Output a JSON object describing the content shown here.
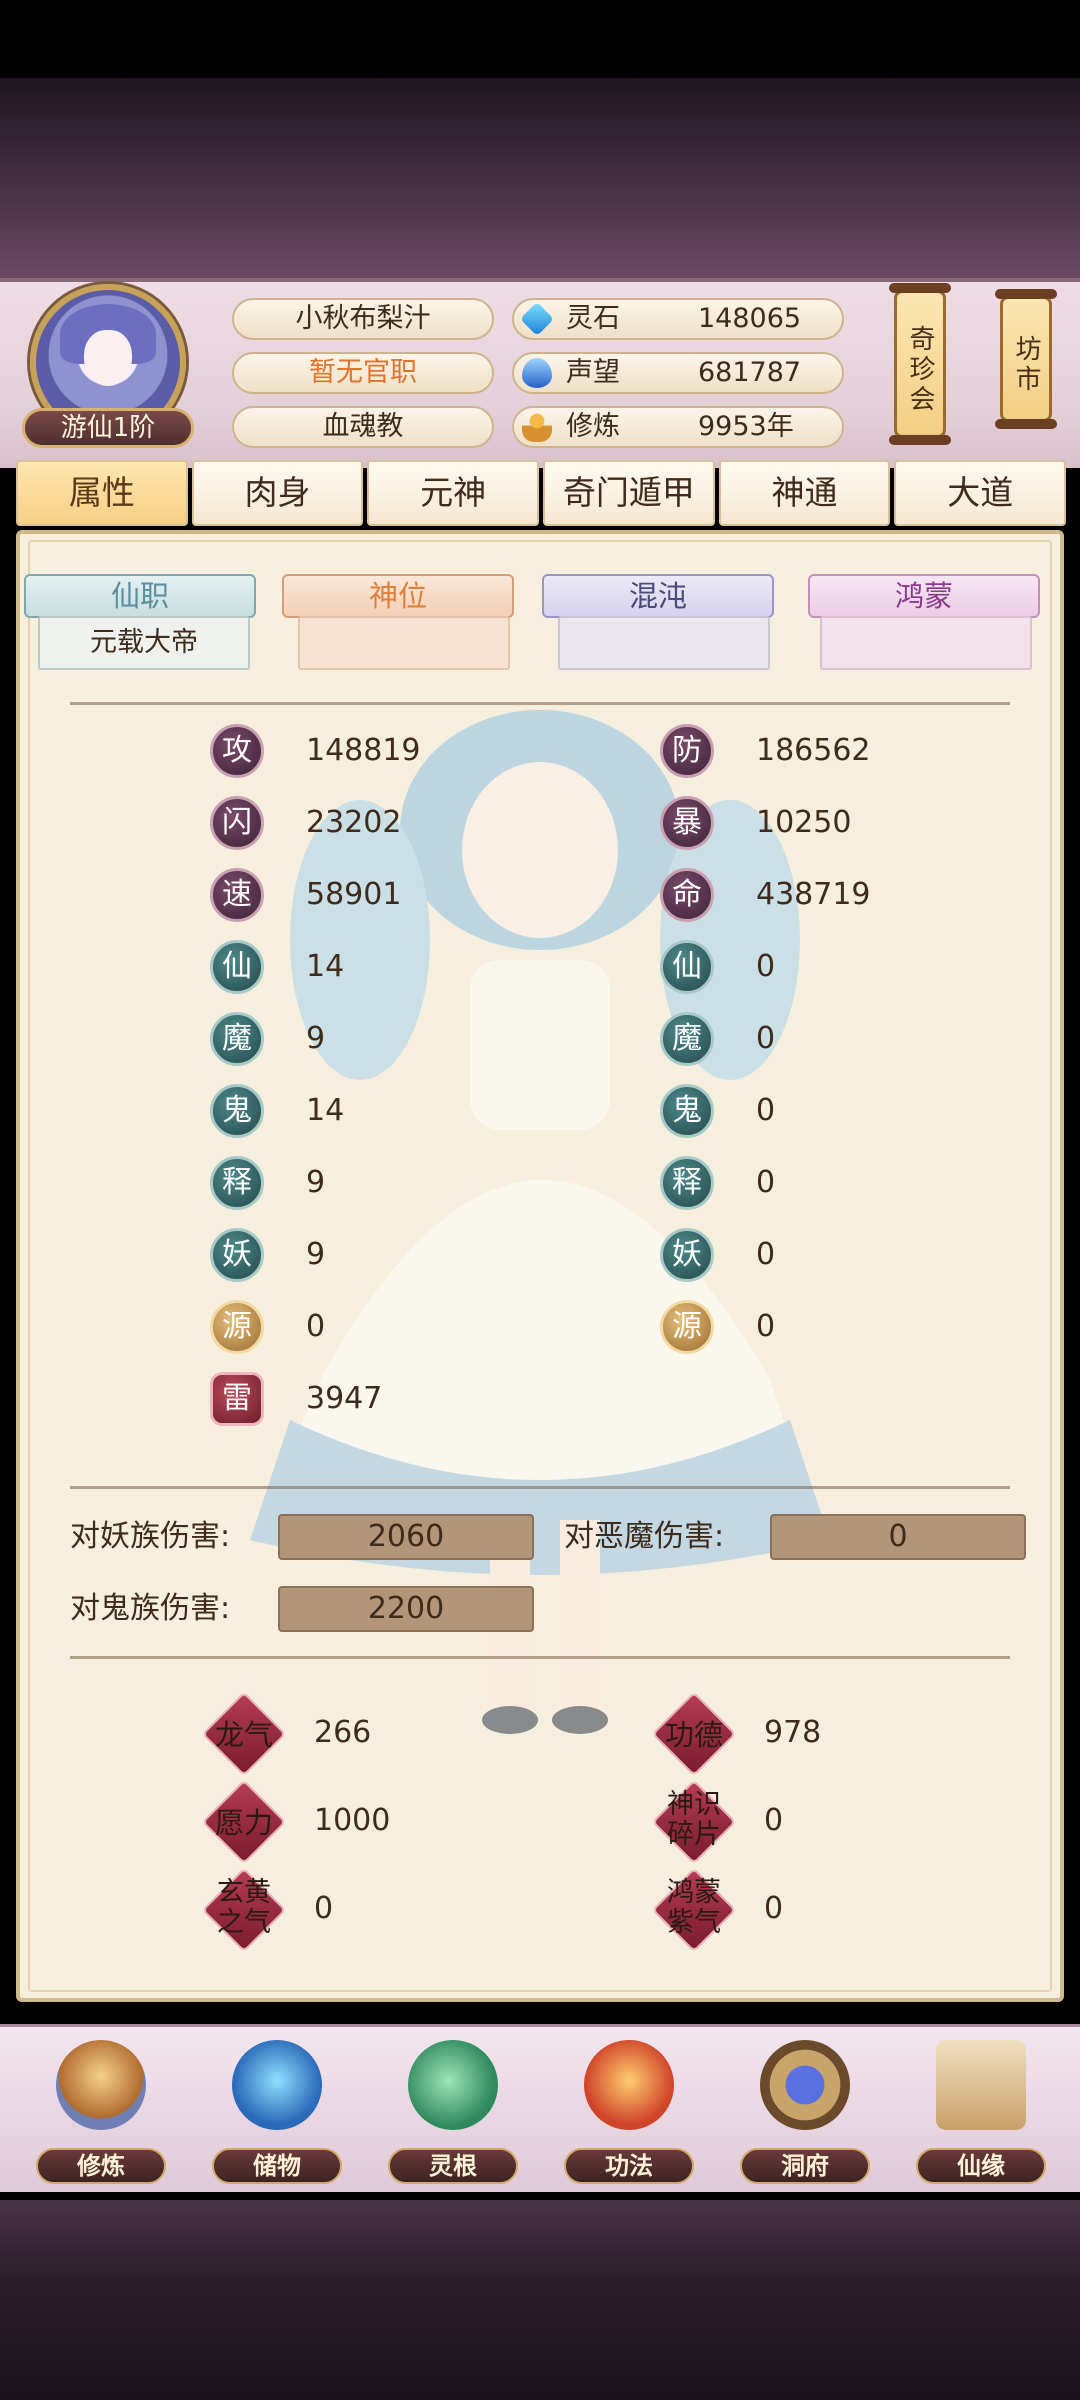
{
  "player": {
    "rank": "游仙1阶",
    "name": "小秋布梨汁",
    "office": "暂无官职",
    "sect": "血魂教"
  },
  "resources": [
    {
      "label": "灵石",
      "value": "148065",
      "icon": "spirit-stone-icon"
    },
    {
      "label": "声望",
      "value": "681787",
      "icon": "reputation-icon"
    },
    {
      "label": "修炼",
      "value": "9953年",
      "icon": "cultivation-icon"
    }
  ],
  "side_buttons": {
    "treasure_hall": "奇珍会",
    "market": "坊市"
  },
  "tabs": [
    "属性",
    "肉身",
    "元神",
    "奇门遁甲",
    "神通",
    "大道"
  ],
  "active_tab": 0,
  "rank_tabs": [
    {
      "label": "仙职",
      "value": "元载大帝"
    },
    {
      "label": "神位",
      "value": ""
    },
    {
      "label": "混沌",
      "value": ""
    },
    {
      "label": "鸿蒙",
      "value": ""
    }
  ],
  "stats_left": [
    {
      "badge": "攻",
      "value": "148819"
    },
    {
      "badge": "闪",
      "value": "23202"
    },
    {
      "badge": "速",
      "value": "58901"
    },
    {
      "badge": "仙",
      "value": "14"
    },
    {
      "badge": "魔",
      "value": "9"
    },
    {
      "badge": "鬼",
      "value": "14"
    },
    {
      "badge": "释",
      "value": "9"
    },
    {
      "badge": "妖",
      "value": "9"
    },
    {
      "badge": "源",
      "value": "0"
    },
    {
      "badge": "雷",
      "value": "3947"
    }
  ],
  "stats_right": [
    {
      "badge": "防",
      "value": "186562"
    },
    {
      "badge": "暴",
      "value": "10250"
    },
    {
      "badge": "命",
      "value": "438719"
    },
    {
      "badge": "仙",
      "value": "0"
    },
    {
      "badge": "魔",
      "value": "0"
    },
    {
      "badge": "鬼",
      "value": "0"
    },
    {
      "badge": "释",
      "value": "0"
    },
    {
      "badge": "妖",
      "value": "0"
    },
    {
      "badge": "源",
      "value": "0"
    }
  ],
  "damage": {
    "yao_label": "对妖族伤害:",
    "yao_value": "2060",
    "emo_label": "对恶魔伤害:",
    "emo_value": "0",
    "gui_label": "对鬼族伤害:",
    "gui_value": "2200"
  },
  "extra_stats": [
    {
      "label": "龙气",
      "value": "266"
    },
    {
      "label": "功德",
      "value": "978"
    },
    {
      "label": "愿力",
      "value": "1000"
    },
    {
      "label": "神识碎片",
      "value": "0"
    },
    {
      "label": "玄黄之气",
      "value": "0"
    },
    {
      "label": "鸿蒙紫气",
      "value": "0"
    }
  ],
  "nav": [
    "修炼",
    "储物",
    "灵根",
    "功法",
    "洞府",
    "仙缘"
  ]
}
